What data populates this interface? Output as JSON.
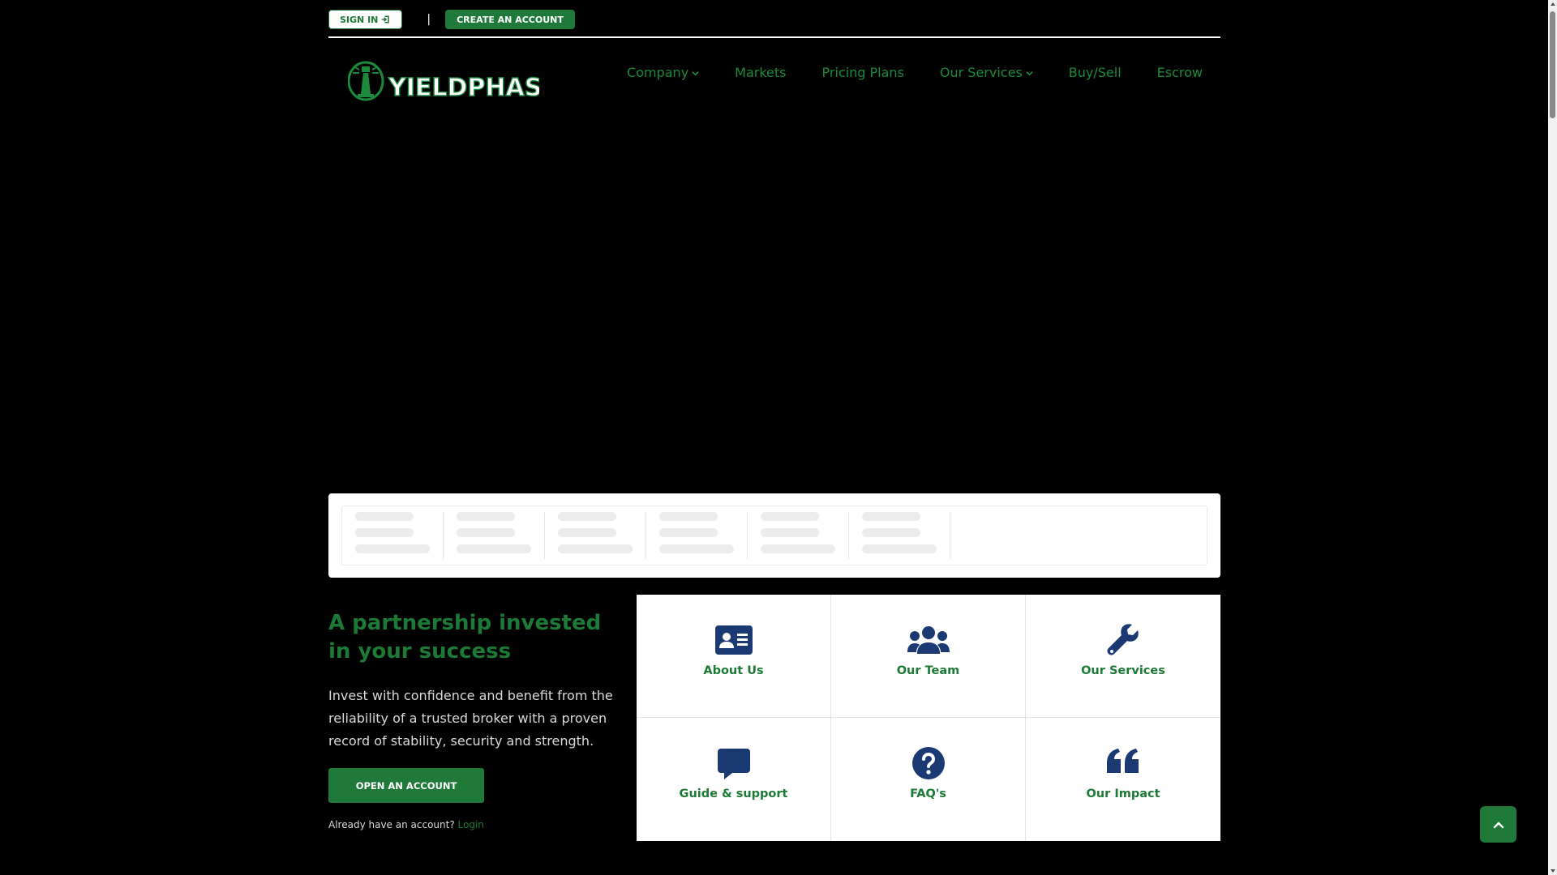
{
  "topbar": {
    "signin_label": "SIGN IN",
    "divider": "|",
    "create_label": "CREATE AN ACCOUNT"
  },
  "brand": {
    "name": "YIELDPHASE",
    "accent": "#1c8a3c"
  },
  "nav": {
    "items": [
      {
        "label": "Company",
        "icon": "chevron-down-icon"
      },
      {
        "label": "Markets"
      },
      {
        "label": "Pricing Plans"
      },
      {
        "label": "Our Services",
        "icon": "chevron-down-icon"
      },
      {
        "label": "Buy/Sell"
      },
      {
        "label": "Escrow"
      }
    ]
  },
  "partner": {
    "title": "A partnership invested in your success",
    "text": "Invest with confidence and benefit from the reliability of a trusted broker with a proven record of stability, security and strength.",
    "button": "OPEN AN ACCOUNT",
    "already": "Already have an account?",
    "login": "Login"
  },
  "cards": [
    {
      "label": "About Us",
      "icon": "id-card-icon"
    },
    {
      "label": "Our Team",
      "icon": "users-icon"
    },
    {
      "label": "Our Services",
      "icon": "wrench-icon"
    },
    {
      "label": "Guide & support",
      "icon": "comment-icon"
    },
    {
      "label": "FAQ's",
      "icon": "question-circle-icon"
    },
    {
      "label": "Our Impact",
      "icon": "quote-icon"
    }
  ],
  "colors": {
    "green": "#1f7a3a",
    "icon_navy": "#1b3a73"
  }
}
